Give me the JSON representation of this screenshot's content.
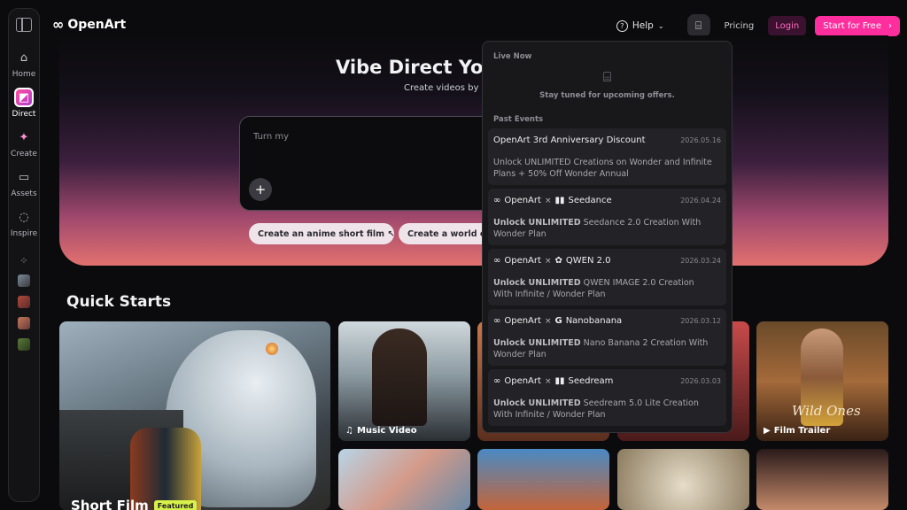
{
  "brand": {
    "name": "OpenArt"
  },
  "nav": {
    "help": "Help",
    "pricing": "Pricing",
    "login": "Login",
    "start": "Start for Free"
  },
  "sidebar": {
    "items": [
      {
        "label": "Home",
        "icon": "home-icon"
      },
      {
        "label": "Direct",
        "icon": "direct-icon",
        "active": true
      },
      {
        "label": "Create",
        "icon": "sparkle-icon"
      },
      {
        "label": "Assets",
        "icon": "folder-icon"
      },
      {
        "label": "Inspire",
        "icon": "bulb-icon"
      }
    ]
  },
  "hero": {
    "title": "Vibe Direct Your",
    "subtitle": "Create videos by ch",
    "prompt_placeholder": "Turn my",
    "chips": [
      "Create an anime short film ↖",
      "Create a world cu"
    ]
  },
  "quick_starts": {
    "title": "Quick Starts",
    "cards": [
      {
        "label": "Short Film",
        "badge": "Featured"
      },
      {
        "label": "Music Video",
        "icon": "music-note-icon"
      },
      {
        "label": "Film Trailer",
        "icon": "clapper-icon"
      }
    ]
  },
  "dropdown": {
    "live_now": "Live Now",
    "empty": "Stay tuned for upcoming offers.",
    "past_events": "Past Events",
    "events": [
      {
        "title": "OpenArt 3rd Anniversary Discount",
        "date": "2026.05.16",
        "bold": "",
        "desc": "Unlock UNLIMITED Creations on Wonder and Infinite Plans + 50% Off Wonder Annual"
      },
      {
        "partner": "Seedance",
        "date": "2026.04.24",
        "bold": "Unlock UNLIMITED",
        "desc": "Seedance 2.0 Creation With Wonder Plan"
      },
      {
        "partner": "QWEN 2.0",
        "date": "2026.03.24",
        "bold": "Unlock UNLIMITED",
        "desc": "QWEN IMAGE 2.0 Creation With Infinite / Wonder Plan"
      },
      {
        "partner": "Nanobanana",
        "date": "2026.03.12",
        "bold": "Unlock UNLIMITED",
        "desc": "Nano Banana 2 Creation With Wonder Plan"
      },
      {
        "partner": "Seedream",
        "date": "2026.03.03",
        "bold": "Unlock UNLIMITED",
        "desc": "Seedream 5.0 Lite Creation With Infinite / Wonder Plan"
      }
    ]
  },
  "colors": {
    "accent": "#ff2e9e",
    "featured": "#d8f04a"
  }
}
